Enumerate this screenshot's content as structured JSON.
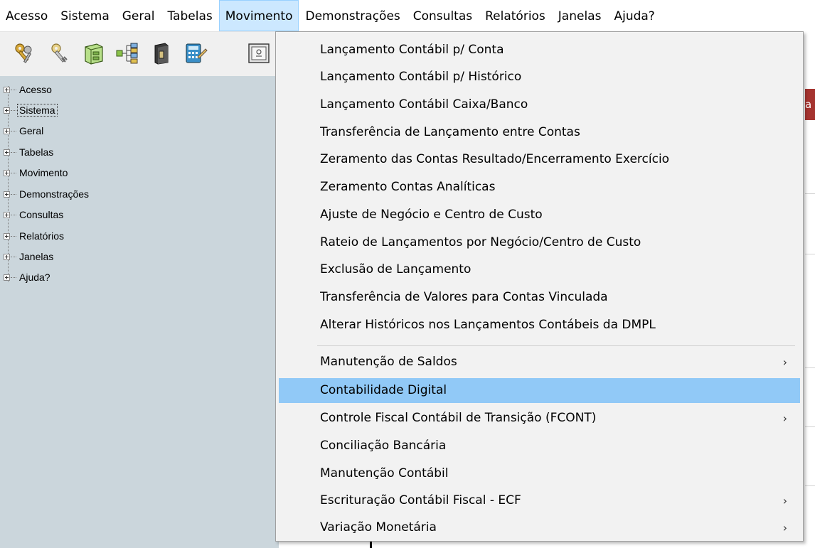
{
  "menubar": {
    "items": [
      "Acesso",
      "Sistema",
      "Geral",
      "Tabelas",
      "Movimento",
      "Demonstrações",
      "Consultas",
      "Relatórios",
      "Janelas",
      "Ajuda?"
    ],
    "open": "Movimento"
  },
  "toolbar": {
    "icons": [
      "keys-gold-icon",
      "keys-grey-icon",
      "cabinet-icon",
      "hierarchy-icon",
      "binder-icon",
      "calculator-icon",
      "safe-icon"
    ]
  },
  "tree": {
    "items": [
      "Acesso",
      "Sistema",
      "Geral",
      "Tabelas",
      "Movimento",
      "Demonstrações",
      "Consultas",
      "Relatórios",
      "Janelas",
      "Ajuda?"
    ],
    "focused": "Sistema"
  },
  "background": {
    "red_label_fragment": "a",
    "red_color": "#a5332f"
  },
  "dropdown": {
    "items": [
      {
        "label": "Lançamento Contábil p/ Conta",
        "submenu": false
      },
      {
        "label": "Lançamento Contábil p/ Histórico",
        "submenu": false
      },
      {
        "label": "Lançamento Contábil Caixa/Banco",
        "submenu": false
      },
      {
        "label": "Transferência de Lançamento entre Contas",
        "submenu": false
      },
      {
        "label": "Zeramento das Contas Resultado/Encerramento Exercício",
        "submenu": false
      },
      {
        "label": "Zeramento Contas Analíticas",
        "submenu": false
      },
      {
        "label": "Ajuste de Negócio e Centro de Custo",
        "submenu": false
      },
      {
        "label": "Rateio de Lançamentos por Negócio/Centro de Custo",
        "submenu": false
      },
      {
        "label": "Exclusão de Lançamento",
        "submenu": false
      },
      {
        "label": "Transferência de Valores para Contas Vinculada",
        "submenu": false
      },
      {
        "label": "Alterar Históricos nos Lançamentos Contábeis da DMPL",
        "submenu": false
      },
      {
        "label": "Manutenção de Saldos",
        "submenu": true
      },
      {
        "label": "Contabilidade Digital",
        "submenu": false,
        "highlighted": true
      },
      {
        "label": "Controle Fiscal Contábil de Transição (FCONT)",
        "submenu": true
      },
      {
        "label": "Conciliação Bancária",
        "submenu": false
      },
      {
        "label": "Manutenção Contábil",
        "submenu": false
      },
      {
        "label": "Escrituração Contábil Fiscal - ECF",
        "submenu": true
      },
      {
        "label": "Variação Monetária",
        "submenu": true
      }
    ],
    "submenu_arrow": "›",
    "highlight_color": "#91c9f7"
  }
}
